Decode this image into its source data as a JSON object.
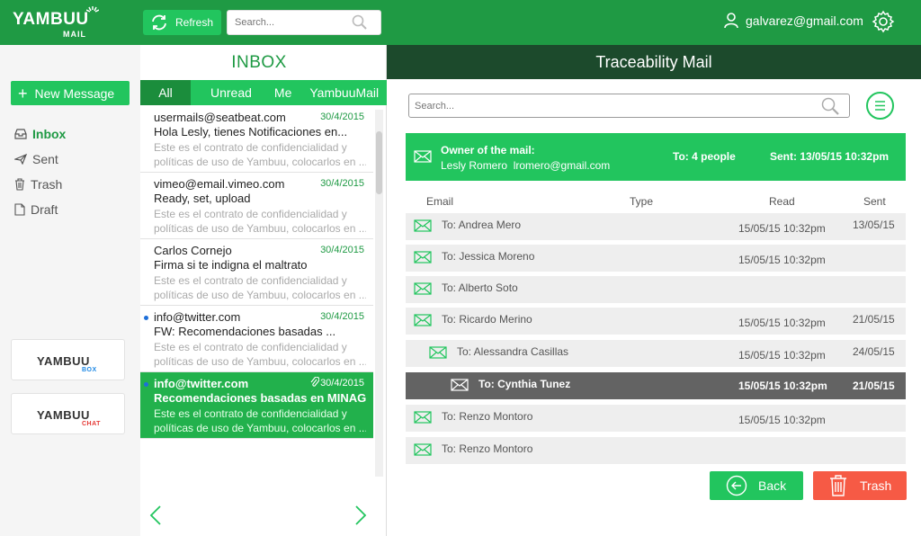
{
  "brand": {
    "logo_main": "YAMBUU",
    "logo_sub": "MAIL"
  },
  "toolbar": {
    "refresh_label": "Refresh",
    "search_placeholder": "Search..."
  },
  "user": {
    "email": "galvarez@gmail.com"
  },
  "sidebar": {
    "new_message_label": "New Message",
    "items": [
      {
        "label": "Inbox",
        "icon": "inbox-icon",
        "active": true
      },
      {
        "label": "Sent",
        "icon": "send-icon",
        "active": false
      },
      {
        "label": "Trash",
        "icon": "trash-icon",
        "active": false
      },
      {
        "label": "Draft",
        "icon": "draft-icon",
        "active": false
      }
    ],
    "apps": [
      {
        "name": "YAMBUU",
        "sub": "BOX",
        "color": "#1e88e5"
      },
      {
        "name": "YAMBUU",
        "sub": "CHAT",
        "color": "#e53935"
      }
    ]
  },
  "inbox": {
    "title": "INBOX",
    "tabs": [
      "All",
      "Unread",
      "Me",
      "YambuuMail"
    ],
    "messages": [
      {
        "from": "usermails@seatbeat.com",
        "date": "30/4/2015",
        "subject": "Hola Lesly, tienes Notificaciones en...",
        "preview1": "Este es el contrato de confidencialidad y",
        "preview2": "políticas de uso de Yambuu, colocarlos en ..."
      },
      {
        "from": "vimeo@email.vimeo.com",
        "date": "30/4/2015",
        "subject": "Ready, set, upload",
        "preview1": "Este es el contrato de confidencialidad y",
        "preview2": "políticas de uso de Yambuu, colocarlos en ..."
      },
      {
        "from": "Carlos Cornejo",
        "date": "30/4/2015",
        "subject": "Firma si te indigna el maltrato",
        "preview1": "Este es el contrato de confidencialidad y",
        "preview2": "políticas de uso de Yambuu, colocarlos en ..."
      },
      {
        "from": "info@twitter.com",
        "date": "30/4/2015",
        "subject": "FW: Recomendaciones basadas ...",
        "preview1": "Este es el contrato de confidencialidad y",
        "preview2": "políticas de uso de Yambuu, colocarlos en ..."
      },
      {
        "from": "info@twitter.com",
        "date": "30/4/2015",
        "subject": "Recomendaciones basadas en MINAGRI",
        "preview1": "Este es el contrato de confidencialidad y",
        "preview2": "políticas de uso de Yambuu, colocarlos en ..."
      }
    ]
  },
  "trace": {
    "title": "Traceability Mail",
    "search_placeholder": "Search...",
    "owner_title": "Owner of the mail:",
    "owner_name": "Lesly Romero",
    "owner_email": "lromero@gmail.com",
    "to_summary": "To: 4 people",
    "sent_label": "Sent:",
    "sent_value": "13/05/15  10:32pm",
    "columns": {
      "email": "Email",
      "type": "Type",
      "read": "Read",
      "sent": "Sent"
    },
    "rows": [
      {
        "to": "To: Andrea Mero",
        "read": "15/05/15  10:32pm",
        "sent": "13/05/15"
      },
      {
        "to": "To: Jessica Moreno",
        "read": "15/05/15  10:32pm",
        "sent": ""
      },
      {
        "to": "To: Alberto Soto",
        "read": "",
        "sent": ""
      },
      {
        "to": "To: Ricardo Merino",
        "read": "15/05/15  10:32pm",
        "sent": "21/05/15"
      },
      {
        "to": "To: Alessandra Casillas",
        "read": "15/05/15  10:32pm",
        "sent": "24/05/15"
      },
      {
        "to": "To: Cynthia Tunez",
        "read": "15/05/15  10:32pm",
        "sent": "21/05/15"
      },
      {
        "to": "To: Renzo Montoro",
        "read": "15/05/15  10:32pm",
        "sent": ""
      },
      {
        "to": "To: Renzo Montoro",
        "read": "",
        "sent": ""
      }
    ],
    "back_label": "Back",
    "trash_label": "Trash"
  },
  "colors": {
    "brand_green": "#1f9a44",
    "accent_green": "#22c55e",
    "dark_header": "#1c4a2c",
    "danger": "#f65a45",
    "selected_row": "#636363"
  }
}
